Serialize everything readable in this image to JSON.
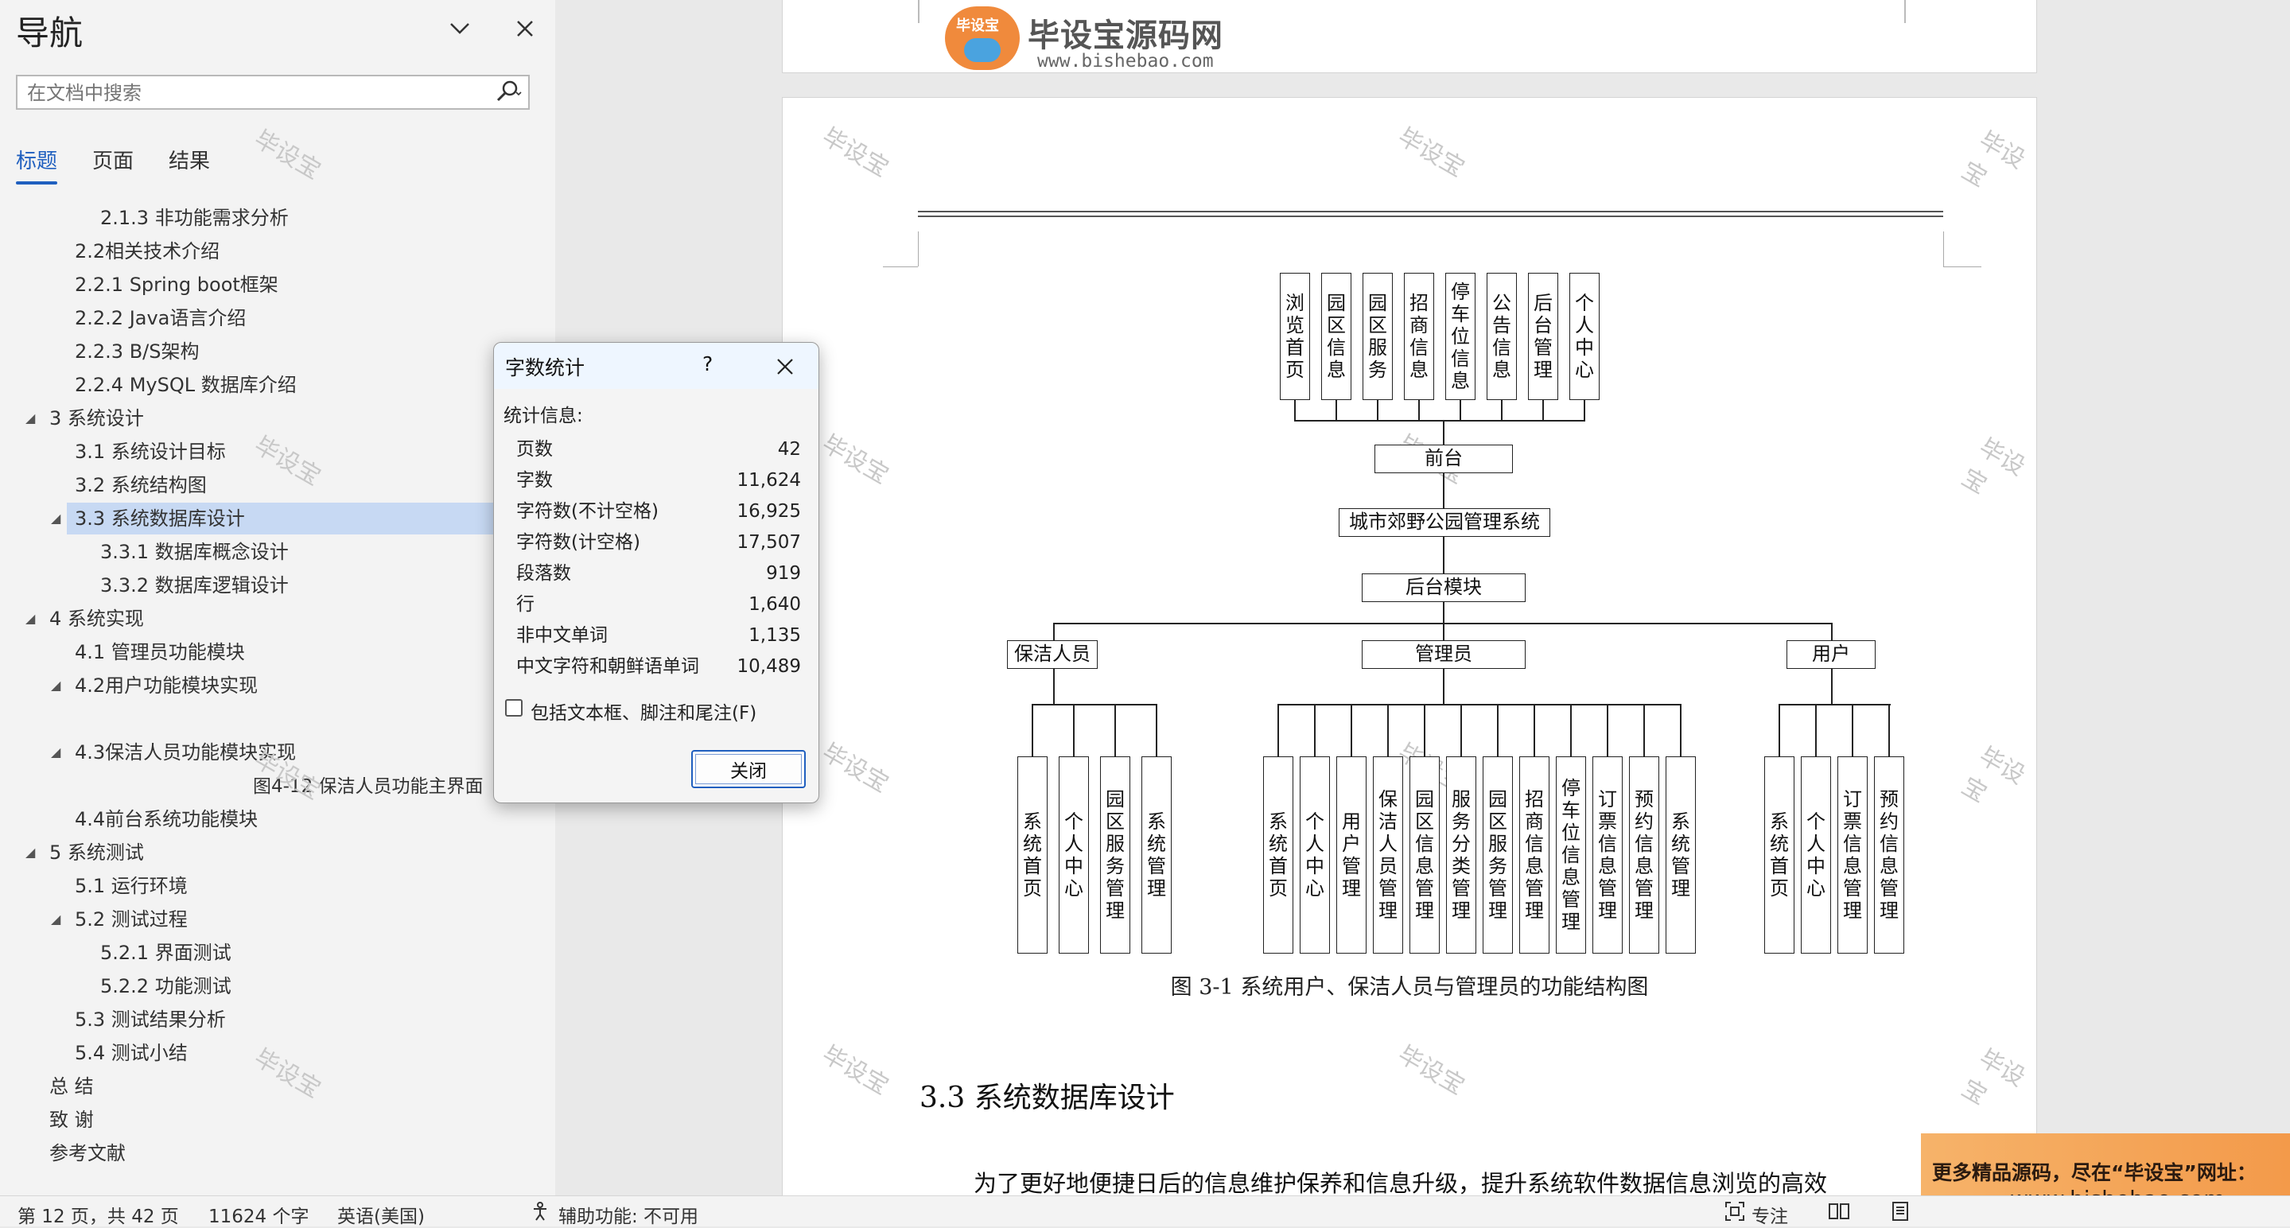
{
  "nav": {
    "title": "导航",
    "search_placeholder": "在文档中搜索",
    "tabs": [
      "标题",
      "页面",
      "结果"
    ],
    "outline": [
      {
        "label": "2.1.3 非功能需求分析",
        "level": 3
      },
      {
        "label": "2.2相关技术介绍",
        "level": 2
      },
      {
        "label": "2.2.1 Spring boot框架",
        "level": 2
      },
      {
        "label": "2.2.2 Java语言介绍",
        "level": 2
      },
      {
        "label": "2.2.3 B/S架构",
        "level": 2
      },
      {
        "label": "2.2.4 MySQL 数据库介绍",
        "level": 2
      },
      {
        "label": "3 系统设计",
        "level": 1
      },
      {
        "label": "3.1 系统设计目标",
        "level": 2
      },
      {
        "label": "3.2 系统结构图",
        "level": 2
      },
      {
        "label": "3.3 系统数据库设计",
        "level": 2,
        "selected": true
      },
      {
        "label": "3.3.1 数据库概念设计",
        "level": 3
      },
      {
        "label": "3.3.2 数据库逻辑设计",
        "level": 3
      },
      {
        "label": "4 系统实现",
        "level": 1
      },
      {
        "label": "4.1  管理员功能模块",
        "level": 2
      },
      {
        "label": "4.2用户功能模块实现",
        "level": 2
      },
      {
        "label": "",
        "level": 2
      },
      {
        "label": "4.3保洁人员功能模块实现",
        "level": 2
      },
      {
        "label": "图4-12 保洁人员功能主界面",
        "level": 4
      },
      {
        "label": "4.4前台系统功能模块",
        "level": 2
      },
      {
        "label": "5 系统测试",
        "level": 1
      },
      {
        "label": "5.1 运行环境",
        "level": 2
      },
      {
        "label": "5.2 测试过程",
        "level": 2
      },
      {
        "label": "5.2.1 界面测试",
        "level": 3
      },
      {
        "label": "5.2.2 功能测试",
        "level": 3
      },
      {
        "label": "5.3 测试结果分析",
        "level": 2
      },
      {
        "label": "5.4 测试小结",
        "level": 2
      },
      {
        "label": "总  结",
        "level": 1
      },
      {
        "label": "致  谢",
        "level": 1
      },
      {
        "label": "参考文献",
        "level": 1
      }
    ]
  },
  "dialog": {
    "title": "字数统计",
    "help": "?",
    "section_label": "统计信息:",
    "stats": [
      {
        "label": "页数",
        "value": "42"
      },
      {
        "label": "字数",
        "value": "11,624"
      },
      {
        "label": "字符数(不计空格)",
        "value": "16,925"
      },
      {
        "label": "字符数(计空格)",
        "value": "17,507"
      },
      {
        "label": "段落数",
        "value": "919"
      },
      {
        "label": "行",
        "value": "1,640"
      },
      {
        "label": "非中文单词",
        "value": "1,135"
      },
      {
        "label": "中文字符和朝鲜语单词",
        "value": "10,489"
      }
    ],
    "checkbox_label": "包括文本框、脚注和尾注(F)",
    "close_label": "关闭"
  },
  "status": {
    "page": "第 12 页，共 42 页",
    "words": "11624 个字",
    "lang": "英语(美国)",
    "accessibility": "辅助功能: 不可用",
    "focus": "专注"
  },
  "logo": {
    "name": "毕设宝源码网",
    "url": "www.bishebao.com",
    "badge": "毕设宝"
  },
  "watermark": "毕设宝",
  "figure": {
    "front_top": [
      "浏览首页",
      "园区信息",
      "园区服务",
      "招商信息",
      "停车位信息",
      "公告信息",
      "后台管理",
      "个人中心"
    ],
    "front": "前台",
    "system": "城市郊野公园管理系统",
    "backend": "后台模块",
    "roles": [
      "保洁人员",
      "管理员",
      "用户"
    ],
    "cleaner": [
      "系统首页",
      "个人中心",
      "园区服务管理",
      "系统管理"
    ],
    "admin": [
      "系统首页",
      "个人中心",
      "用户管理",
      "保洁人员管理",
      "园区信息管理",
      "服务分类管理",
      "园区服务管理",
      "招商信息管理",
      "停车位信息管理",
      "订票信息管理",
      "预约信息管理",
      "系统管理"
    ],
    "user": [
      "系统首页",
      "个人中心",
      "订票信息管理",
      "预约信息管理"
    ],
    "caption": "图 3-1  系统用户、保洁人员与管理员的功能结构图"
  },
  "doc": {
    "heading": "3.3  系统数据库设计",
    "body": "为了更好地便捷日后的信息维护保养和信息升级，提升系统软件数据信息浏览的高效"
  },
  "ad": {
    "line1": "更多精品源码，尽在“毕设宝”网址：",
    "line2": "www.bishebao.com"
  }
}
